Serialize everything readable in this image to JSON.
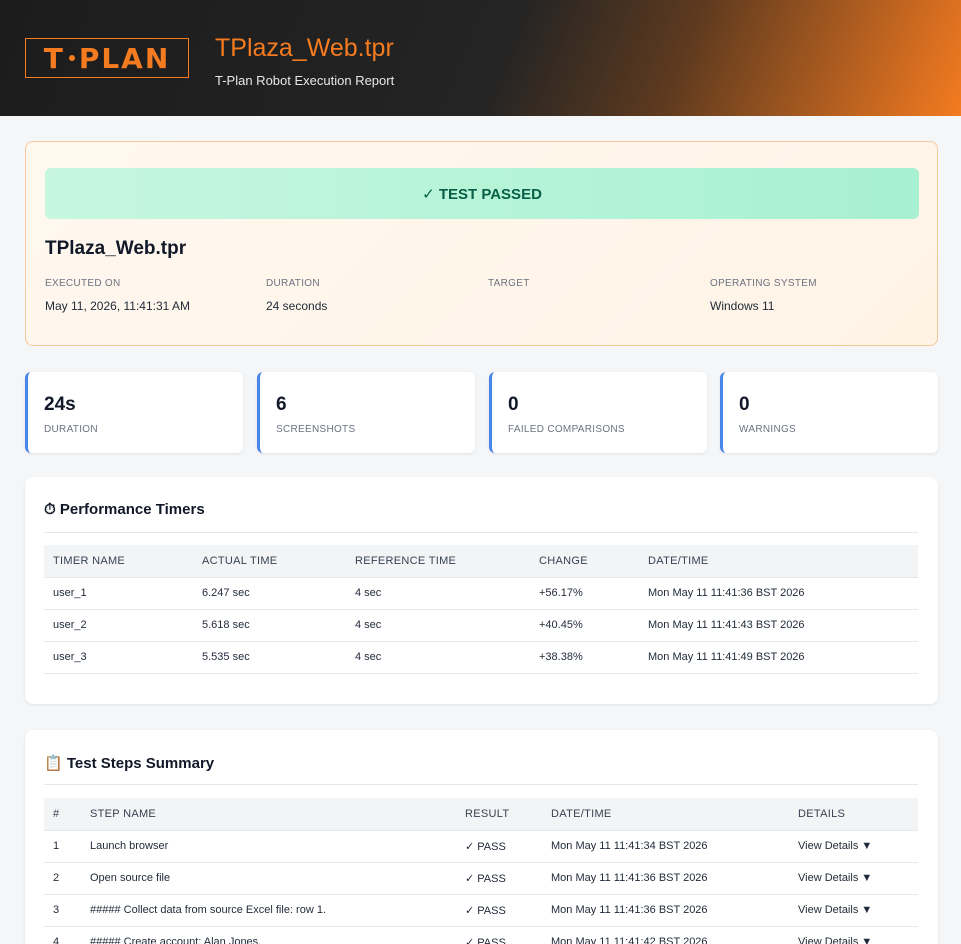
{
  "header": {
    "logo_text_left": "T",
    "logo_text_right": "PLAN",
    "title": "TPlaza_Web.tpr",
    "subtitle": "T-Plan Robot Execution Report"
  },
  "status": {
    "banner": "✓ TEST PASSED",
    "script_name": "TPlaza_Web.tpr",
    "meta": [
      {
        "label": "Executed On",
        "value": "May 11, 2026, 11:41:31 AM"
      },
      {
        "label": "Duration",
        "value": "24 seconds"
      },
      {
        "label": "Target",
        "value": ""
      },
      {
        "label": "Operating System",
        "value": "Windows 11"
      }
    ]
  },
  "stats": [
    {
      "value": "24s",
      "label": "Duration"
    },
    {
      "value": "6",
      "label": "Screenshots"
    },
    {
      "value": "0",
      "label": "Failed Comparisons"
    },
    {
      "value": "0",
      "label": "Warnings"
    }
  ],
  "timers": {
    "title": "⏱ Performance Timers",
    "columns": [
      "Timer Name",
      "Actual Time",
      "Reference Time",
      "Change",
      "Date/Time"
    ],
    "rows": [
      {
        "name": "user_1",
        "actual": "6.247 sec",
        "reference": "4 sec",
        "change": "+56.17%",
        "datetime": "Mon May 11 11:41:36 BST 2026"
      },
      {
        "name": "user_2",
        "actual": "5.618 sec",
        "reference": "4 sec",
        "change": "+40.45%",
        "datetime": "Mon May 11 11:41:43 BST 2026"
      },
      {
        "name": "user_3",
        "actual": "5.535 sec",
        "reference": "4 sec",
        "change": "+38.38%",
        "datetime": "Mon May 11 11:41:49 BST 2026"
      }
    ]
  },
  "steps": {
    "title": "📋 Test Steps Summary",
    "columns": [
      "#",
      "Step Name",
      "Result",
      "Date/Time",
      "Details"
    ],
    "rows": [
      {
        "num": "1",
        "name": "Launch browser",
        "result": "✓ PASS",
        "datetime": "Mon May 11 11:41:34 BST 2026",
        "details": "View Details ▼"
      },
      {
        "num": "2",
        "name": "Open source file",
        "result": "✓ PASS",
        "datetime": "Mon May 11 11:41:36 BST 2026",
        "details": "View Details ▼"
      },
      {
        "num": "3",
        "name": "##### Collect data from source Excel file: row 1.",
        "result": "✓ PASS",
        "datetime": "Mon May 11 11:41:36 BST 2026",
        "details": "View Details ▼"
      },
      {
        "num": "4",
        "name": "##### Create account: Alan Jones.",
        "result": "✓ PASS",
        "datetime": "Mon May 11 11:41:42 BST 2026",
        "details": "View Details ▼"
      }
    ]
  },
  "colors": {
    "accent": "#f47b20",
    "pass": "#15803d",
    "negative": "#dc2626",
    "link": "#2563eb"
  }
}
